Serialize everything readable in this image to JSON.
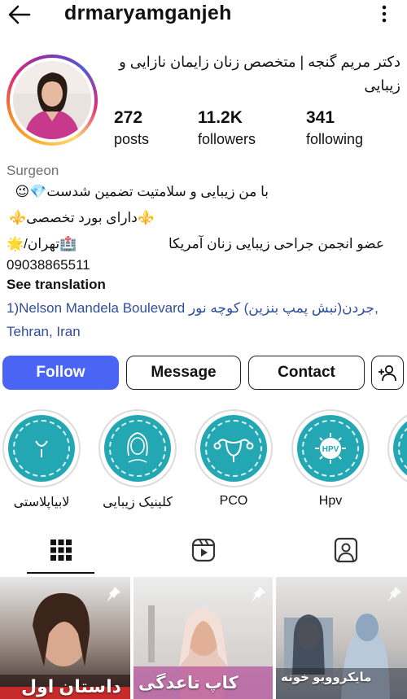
{
  "header": {
    "username": "drmaryamganjeh",
    "back_icon": "arrow-left-icon",
    "more_icon": "more-vertical-icon"
  },
  "profile": {
    "display_name": "دکتر مریم گنجه | متخصص زنان زایمان نازایی و زیبایی",
    "stats": [
      {
        "value": "272",
        "label": "posts"
      },
      {
        "value": "11.2K",
        "label": "followers"
      },
      {
        "value": "341",
        "label": "following"
      }
    ],
    "category": "Surgeon",
    "bio": [
      "با من زیبایی و سلامتیت تضمین شدست💎😉",
      "⚜️دارای بورد تخصصی⚜️",
      "عضو انجمن جراحی زیبایی زنان آمریکا",
      "🏥تهران/🌟",
      "09038865511"
    ],
    "see_translation": "See translation",
    "address": "1)Nelson Mandela Boulevard جردن(نبش پمپ بنزین) کوچه نور, Tehran, Iran"
  },
  "actions": {
    "follow": "Follow",
    "message": "Message",
    "contact": "Contact",
    "add_user_icon": "add-person-icon"
  },
  "highlights": [
    {
      "label": "لابیاپلاستی",
      "icon": "labia-icon"
    },
    {
      "label": "کلینیک زیبایی",
      "icon": "woman-face-icon"
    },
    {
      "label": "PCO",
      "icon": "uterus-icon"
    },
    {
      "label": "Hpv",
      "icon": "virus-icon",
      "badge": "HPV"
    },
    {
      "label": "",
      "icon": "partial-highlight"
    }
  ],
  "tabs": [
    {
      "name": "grid",
      "icon": "grid-icon",
      "active": true
    },
    {
      "name": "reels",
      "icon": "reels-icon",
      "active": false
    },
    {
      "name": "tagged",
      "icon": "tagged-person-icon",
      "active": false
    }
  ],
  "posts": [
    {
      "caption": "داستان اول",
      "pinned": true
    },
    {
      "caption": "کاپ تاعدگی",
      "pinned": true
    },
    {
      "caption": "مایکروویو خونه",
      "pinned": true
    }
  ],
  "colors": {
    "accent": "#4a65f6",
    "highlight_teal": "#23a7b3",
    "link": "#2f4d9a"
  }
}
